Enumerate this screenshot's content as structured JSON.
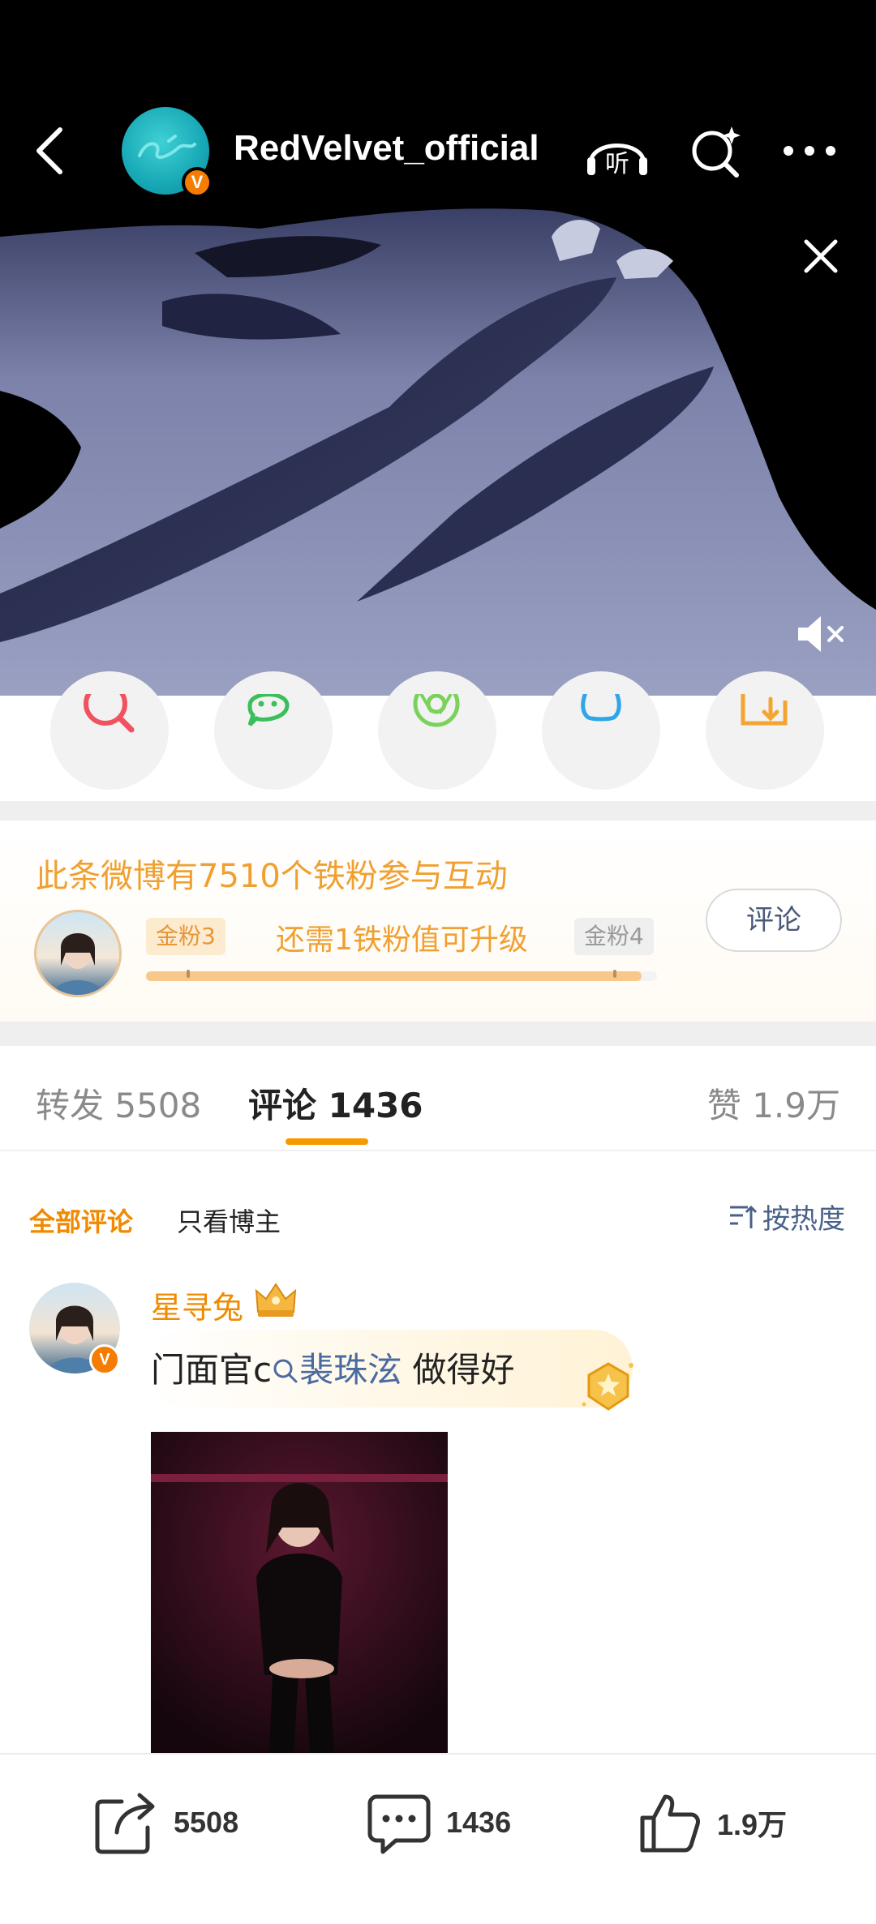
{
  "header": {
    "account_name": "RedVelvet_official",
    "verified_badge": "V",
    "listen_label": "听"
  },
  "fans": {
    "title": "此条微博有7510个铁粉参与互动",
    "level_current": "金粉3",
    "level_next": "金粉4",
    "need_text": "还需1铁粉值可升级",
    "progress": 0.97,
    "comment_button": "评论"
  },
  "tabs": {
    "repost": "转发 5508",
    "comment": "评论 1436",
    "like": "赞 1.9万"
  },
  "filters": {
    "all": "全部评论",
    "author_only": "只看博主",
    "sort": "按热度"
  },
  "comment": {
    "user": "星寻兔",
    "text_before": "门面官c",
    "link_text": "裴珠泫",
    "text_after": " 做得好",
    "verified_badge": "V"
  },
  "bottom_bar": {
    "repost_count": "5508",
    "comment_count": "1436",
    "like_count": "1.9万"
  },
  "colors": {
    "accent_orange": "#f08a00",
    "link_blue": "#4a6aa0",
    "fan_gold": "#f0a030"
  },
  "icons": {
    "back": "chevron-left-icon",
    "listen": "headphones-icon",
    "search": "search-sparkle-icon",
    "more": "more-dots-icon",
    "close": "close-icon",
    "mute": "speaker-muted-icon",
    "share_targets": [
      "search-icon",
      "wechat-icon",
      "moments-icon",
      "qq-icon",
      "save-icon"
    ],
    "sort": "sort-icon",
    "crown": "crown-icon",
    "gem": "gem-icon",
    "repost": "repost-icon",
    "comment": "comment-icon",
    "like": "thumbs-up-icon"
  }
}
